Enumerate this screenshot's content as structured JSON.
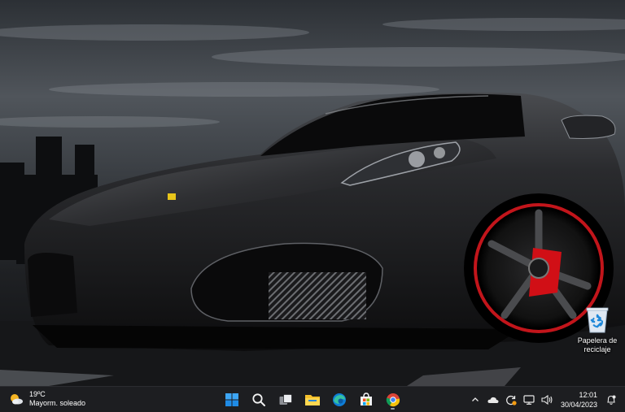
{
  "desktop": {
    "icons": [
      {
        "label": "Papelera de reciclaje",
        "icon": "recycle-bin-icon"
      }
    ]
  },
  "taskbar": {
    "weather": {
      "temperature": "19ºC",
      "condition": "Mayorm. soleado",
      "icon": "partly-sunny-icon"
    },
    "pinned": [
      {
        "name": "Inicio",
        "icon": "windows-start-icon"
      },
      {
        "name": "Buscar",
        "icon": "search-icon"
      },
      {
        "name": "Vista de tareas",
        "icon": "task-view-icon"
      },
      {
        "name": "Explorador de archivos",
        "icon": "file-explorer-icon"
      },
      {
        "name": "Microsoft Edge",
        "icon": "edge-icon"
      },
      {
        "name": "Microsoft Store",
        "icon": "store-icon"
      },
      {
        "name": "Google Chrome",
        "icon": "chrome-icon",
        "running": true
      }
    ],
    "tray": {
      "icons": [
        "chevron-up-icon",
        "onedrive-cloud-icon",
        "update-sync-icon",
        "network-icon",
        "volume-icon"
      ],
      "time": "12:01",
      "date": "30/04/2023",
      "notifications_icon": "notification-bell-icon"
    }
  }
}
